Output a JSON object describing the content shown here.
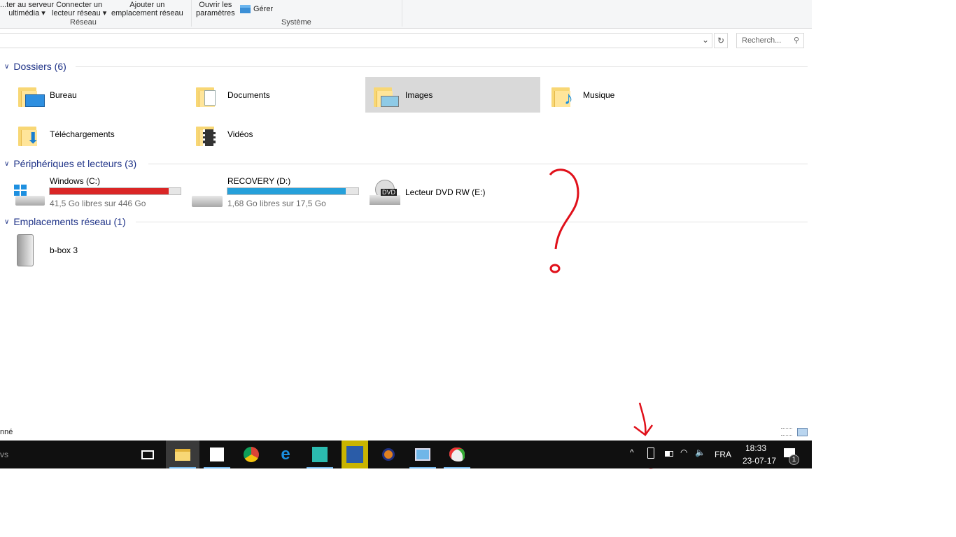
{
  "ribbon": {
    "buttons": [
      {
        "line1": "...ter au serveur",
        "line2": "ultimédia ▾"
      },
      {
        "line1": "Connecter un",
        "line2": "lecteur réseau ▾"
      },
      {
        "line1": "Ajouter un",
        "line2": "emplacement réseau"
      },
      {
        "line1": "Ouvrir les",
        "line2": "paramètres"
      },
      {
        "line1": "",
        "line2": "Gérer"
      }
    ],
    "groups": [
      "Réseau",
      "Système"
    ]
  },
  "address": {
    "value": "",
    "search_placeholder": "Recherch..."
  },
  "sections": {
    "folders": {
      "title": "Dossiers (6)",
      "items": [
        "Bureau",
        "Documents",
        "Images",
        "Musique",
        "Téléchargements",
        "Vidéos"
      ],
      "selected": "Images"
    },
    "devices": {
      "title": "Périphériques et lecteurs (3)",
      "items": [
        {
          "name": "Windows (C:)",
          "info": "41,5 Go libres sur 446 Go",
          "used_fraction": 0.907,
          "bar_color": "#da2626"
        },
        {
          "name": "RECOVERY (D:)",
          "info": "1,68 Go libres sur 17,5 Go",
          "used_fraction": 0.904,
          "bar_color": "#26a0da"
        },
        {
          "name": "Lecteur DVD RW (E:)",
          "badge": "DVD"
        }
      ]
    },
    "network": {
      "title": "Emplacements réseau (1)",
      "items": [
        "b-box 3"
      ]
    }
  },
  "status": {
    "text": "nné"
  },
  "taskbar": {
    "search_text": "vs",
    "apps": [
      "task-view",
      "file-explorer",
      "store",
      "chrome",
      "edge",
      "app-anime",
      "app-v",
      "app-vlc",
      "app-control",
      "app-paint"
    ],
    "tray": {
      "language": "FRA",
      "time": "18:33",
      "date": "23-07-17",
      "notification_count": "1"
    }
  },
  "annotations": {
    "question_mark": "?"
  }
}
